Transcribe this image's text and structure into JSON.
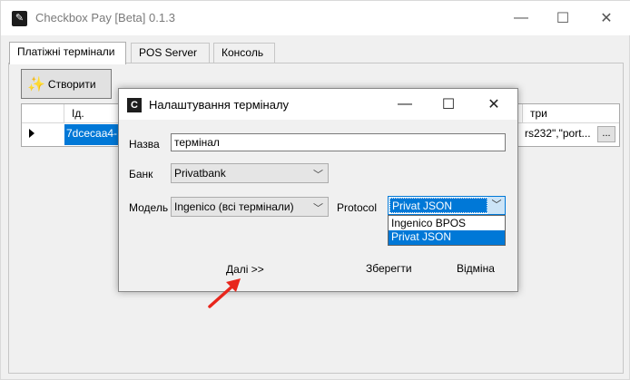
{
  "app": {
    "title": "Checkbox Pay [Beta] 0.1.3"
  },
  "window_controls": {
    "minimize": "—",
    "maximize": "☐",
    "close": "✕"
  },
  "tabs": [
    {
      "label": "Платіжні термінали"
    },
    {
      "label": "POS Server"
    },
    {
      "label": "Консоль"
    }
  ],
  "toolbar": {
    "create_label": "Створити"
  },
  "grid": {
    "columns": [
      "Ід.",
      "три"
    ],
    "rows": [
      {
        "id": "7dcecaa4-",
        "params": "rs232\",\"port..."
      }
    ],
    "ellipsis": "..."
  },
  "dialog": {
    "icon_letter": "C",
    "title": "Налаштування терміналу",
    "controls": {
      "minimize": "—",
      "maximize": "☐",
      "close": "✕"
    },
    "name_label": "Назва",
    "name_value": "термінал",
    "bank_label": "Банк",
    "bank_value": "Privatbank",
    "model_label": "Модель",
    "model_value": "Ingenico (всі термінали)",
    "protocol_label": "Protocol",
    "protocol_value": "Privat JSON",
    "protocol_options": [
      "Ingenico BPOS",
      "Privat JSON"
    ],
    "next_label": "Далі >>",
    "save_label": "Зберегти",
    "cancel_label": "Відміна"
  },
  "annotation": {
    "arrow_color": "#e8261c"
  },
  "colors": {
    "selection": "#0078d7"
  }
}
